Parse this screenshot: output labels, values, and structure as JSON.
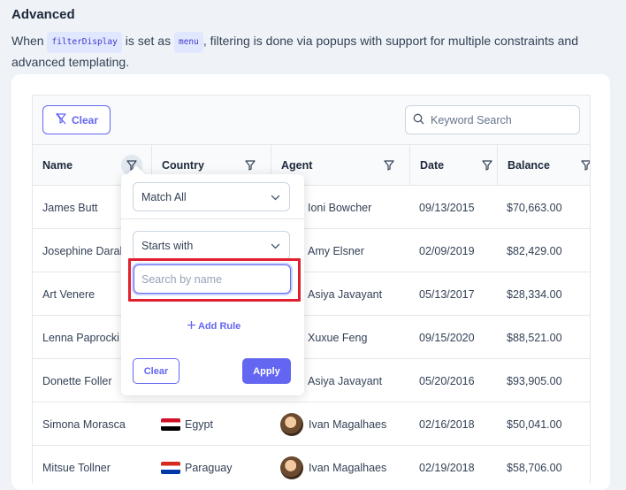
{
  "section": {
    "title": "Advanced",
    "desc_part1": "When",
    "code1": "filterDisplay",
    "desc_part2": "is set as",
    "code2": "menu",
    "desc_part3": ", filtering is done via popups with support for multiple constraints and advanced templating."
  },
  "toolbar": {
    "clear_label": "Clear",
    "search_placeholder": "Keyword Search"
  },
  "columns": [
    {
      "label": "Name"
    },
    {
      "label": "Country"
    },
    {
      "label": "Agent"
    },
    {
      "label": "Date"
    },
    {
      "label": "Balance"
    }
  ],
  "rows": [
    {
      "name": "James Butt",
      "country": "",
      "agent": "Ioni Bowcher",
      "date": "09/13/2015",
      "balance": "$70,663.00"
    },
    {
      "name": "Josephine Darakjy",
      "country": "",
      "agent": "Amy Elsner",
      "date": "02/09/2019",
      "balance": "$82,429.00"
    },
    {
      "name": "Art Venere",
      "country": "",
      "agent": "Asiya Javayant",
      "date": "05/13/2017",
      "balance": "$28,334.00"
    },
    {
      "name": "Lenna Paprocki",
      "country": "",
      "agent": "Xuxue Feng",
      "date": "09/15/2020",
      "balance": "$88,521.00"
    },
    {
      "name": "Donette Foller",
      "country": "",
      "agent": "Asiya Javayant",
      "date": "05/20/2016",
      "balance": "$93,905.00"
    },
    {
      "name": "Simona Morasca",
      "country": "Egypt",
      "agent": "Ivan Magalhaes",
      "date": "02/16/2018",
      "balance": "$50,041.00"
    },
    {
      "name": "Mitsue Tollner",
      "country": "Paraguay",
      "agent": "Ivan Magalhaes",
      "date": "02/19/2018",
      "balance": "$58,706.00"
    }
  ],
  "popup": {
    "match_mode": "Match All",
    "constraint": "Starts with",
    "input_placeholder": "Search by name",
    "add_rule": "Add Rule",
    "clear_label": "Clear",
    "apply_label": "Apply"
  },
  "colors": {
    "accent": "#6366f1",
    "highlight": "#e0202f"
  }
}
